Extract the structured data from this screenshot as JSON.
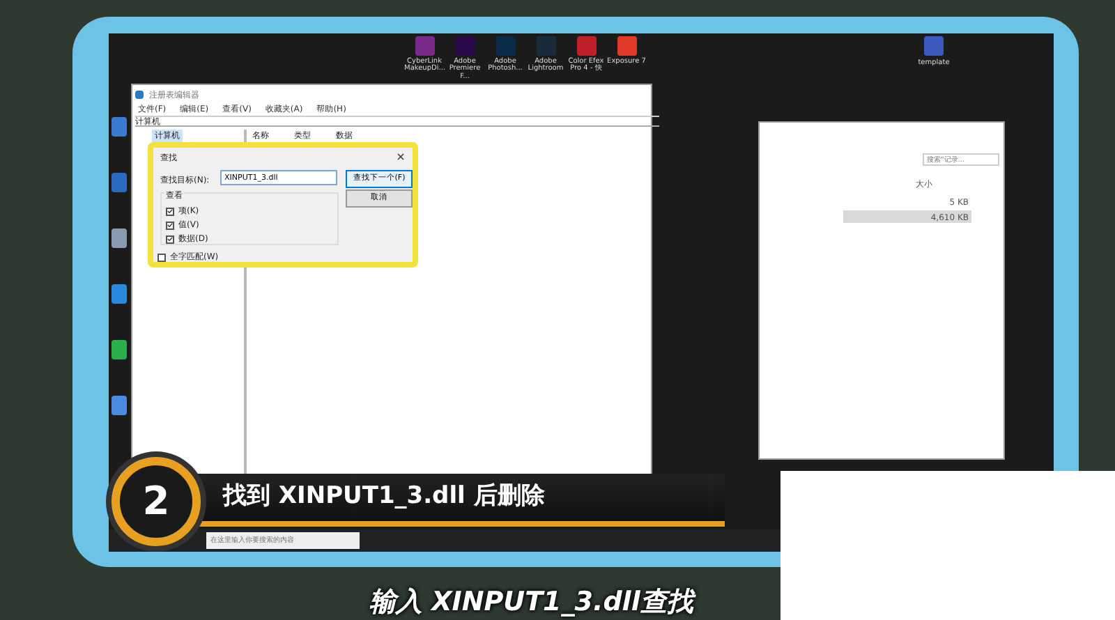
{
  "desktop_icons_top": [
    {
      "label": "CyberLink MakeupDi...",
      "color": "#7a2a8a"
    },
    {
      "label": "Adobe Premiere F...",
      "color": "#2a0a4a"
    },
    {
      "label": "Adobe Photosh...",
      "color": "#0a2a4a"
    },
    {
      "label": "Adobe Lightroom",
      "color": "#1a2a3a"
    },
    {
      "label": "Color Efex Pro 4 - 快",
      "color": "#c0202a"
    },
    {
      "label": "Exposure 7",
      "color": "#e03a2a"
    }
  ],
  "desktop_icons_right": [
    {
      "label": "template",
      "color": "#3a5ac0"
    }
  ],
  "registry_window": {
    "title": "注册表编辑器",
    "menu": [
      "文件(F)",
      "编辑(E)",
      "查看(V)",
      "收藏夹(A)",
      "帮助(H)"
    ],
    "address": "计算机",
    "tree_root": "计算机",
    "columns": [
      "名称",
      "类型",
      "数据"
    ]
  },
  "find_dialog": {
    "title": "查找",
    "target_label": "查找目标(N):",
    "target_value": "XINPUT1_3.dll",
    "buttons": [
      "查找下一个(F)",
      "取消"
    ],
    "group_title": "查看",
    "options": [
      {
        "label": "项(K)",
        "checked": true
      },
      {
        "label": "值(V)",
        "checked": true
      },
      {
        "label": "数据(D)",
        "checked": true
      }
    ],
    "match_whole": {
      "label": "全字匹配(W)",
      "checked": false
    }
  },
  "explorer_window": {
    "search_placeholder": "搜索\"记录...",
    "column": "大小",
    "rows": [
      {
        "size": "5 KB",
        "selected": false
      },
      {
        "size": "4,610 KB",
        "selected": true
      }
    ]
  },
  "taskbar": {
    "search_placeholder": "在这里输入你要搜索的内容"
  },
  "caption": {
    "step": "2",
    "text": "找到 XINPUT1_3.dll 后删除"
  },
  "subtitle": "输入 XINPUT1_3.dll查找"
}
